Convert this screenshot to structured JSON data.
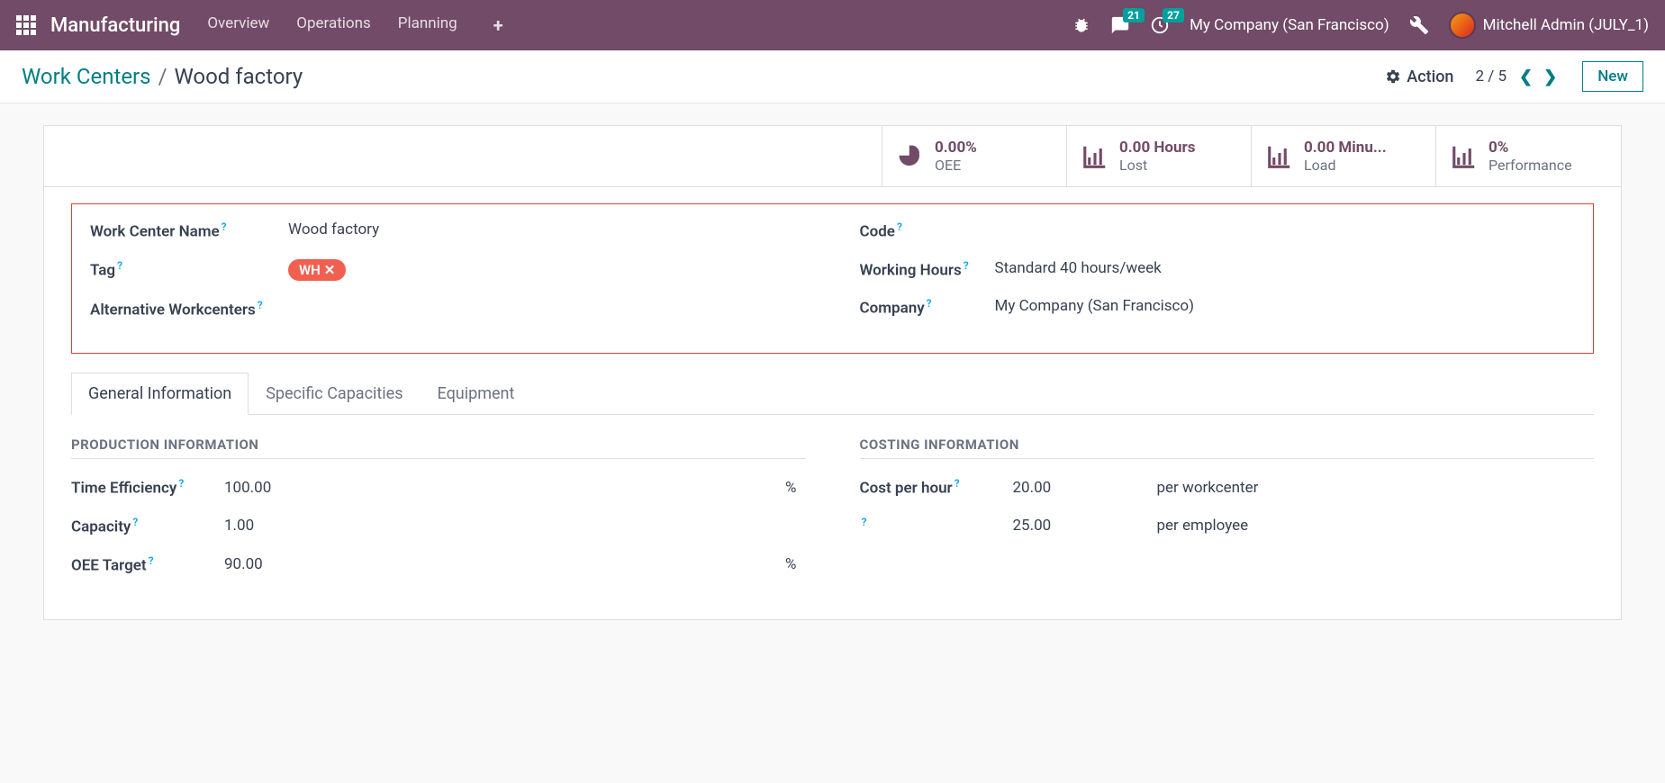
{
  "topbar": {
    "app_title": "Manufacturing",
    "nav": [
      "Overview",
      "Operations",
      "Planning"
    ],
    "msg_badge": "21",
    "activity_badge": "27",
    "company": "My Company (San Francisco)",
    "user": "Mitchell Admin (JULY_1)"
  },
  "control": {
    "breadcrumb_parent": "Work Centers",
    "breadcrumb_current": "Wood factory",
    "action_label": "Action",
    "pager_current": "2",
    "pager_total": "5",
    "new_label": "New"
  },
  "stats": [
    {
      "value": "0.00%",
      "label": "OEE",
      "icon": "pie"
    },
    {
      "value": "0.00 Hours",
      "label": "Lost",
      "icon": "bar"
    },
    {
      "value": "0.00 Minu...",
      "label": "Load",
      "icon": "bar"
    },
    {
      "value": "0%",
      "label": "Performance",
      "icon": "bar"
    }
  ],
  "form": {
    "left": {
      "name_label": "Work Center Name",
      "name_value": "Wood factory",
      "tag_label": "Tag",
      "tag_value": "WH",
      "alt_label": "Alternative Workcenters"
    },
    "right": {
      "code_label": "Code",
      "hours_label": "Working Hours",
      "hours_value": "Standard 40 hours/week",
      "company_label": "Company",
      "company_value": "My Company (San Francisco)"
    }
  },
  "tabs": [
    "General Information",
    "Specific Capacities",
    "Equipment"
  ],
  "sections": {
    "prod": {
      "title": "PRODUCTION INFORMATION",
      "rows": [
        {
          "label": "Time Efficiency",
          "value": "100.00",
          "unit": "%"
        },
        {
          "label": "Capacity",
          "value": "1.00",
          "unit": ""
        },
        {
          "label": "OEE Target",
          "value": "90.00",
          "unit": "%"
        }
      ]
    },
    "cost": {
      "title": "COSTING INFORMATION",
      "rows": [
        {
          "label": "Cost per hour",
          "value": "20.00",
          "unit": "per workcenter"
        },
        {
          "label": "",
          "value": "25.00",
          "unit": "per employee"
        }
      ]
    }
  }
}
